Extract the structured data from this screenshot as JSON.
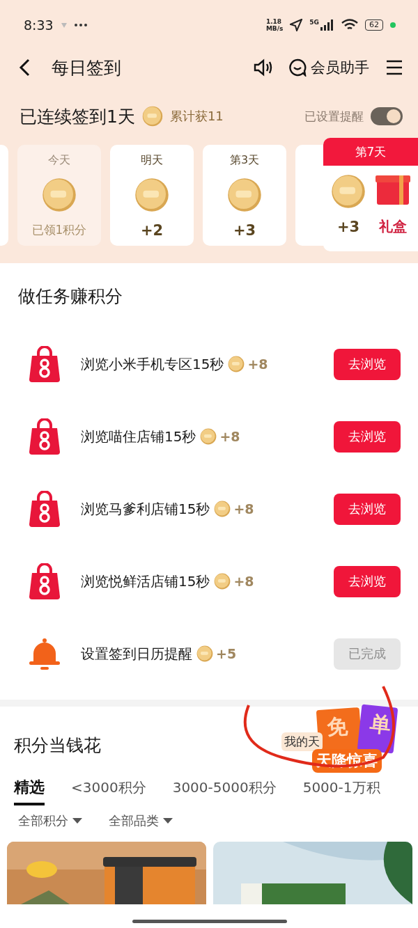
{
  "status_bar": {
    "time": "8:33",
    "speed": [
      "1.18",
      "MB/s"
    ],
    "network": "5G",
    "battery": "62"
  },
  "header": {
    "title": "每日签到",
    "assistant": "会员助手"
  },
  "streak": {
    "text": "已连续签到1天",
    "total": "累计获11",
    "reminder_label": "已设置提醒",
    "reminder_on": true
  },
  "days": [
    {
      "label": "今天",
      "reward": "已领1积分",
      "claimed": true
    },
    {
      "label": "明天",
      "reward": "+2",
      "claimed": false
    },
    {
      "label": "第3天",
      "reward": "+3",
      "claimed": false
    }
  ],
  "final_day": {
    "label": "第7天",
    "reward": "+3",
    "gift": "礼盒"
  },
  "tasks_section": {
    "title": "做任务赚积分",
    "tasks": [
      {
        "kind": "bag",
        "text": "浏览小米手机专区15秒",
        "points": "+8",
        "action": "去浏览",
        "done": false
      },
      {
        "kind": "bag",
        "text": "浏览喵住店铺15秒",
        "points": "+8",
        "action": "去浏览",
        "done": false
      },
      {
        "kind": "bag",
        "text": "浏览马爹利店铺15秒",
        "points": "+8",
        "action": "去浏览",
        "done": false
      },
      {
        "kind": "bag",
        "text": "浏览悦鲜活店铺15秒",
        "points": "+8",
        "action": "去浏览",
        "done": false
      },
      {
        "kind": "bell",
        "text": "设置签到日历提醒",
        "points": "+5",
        "action": "已完成",
        "done": true
      }
    ]
  },
  "promo": {
    "text": "我的天",
    "tickets": [
      "免",
      "单"
    ],
    "banner": "天降惊喜"
  },
  "shop": {
    "title": "积分当钱花",
    "tabs": [
      {
        "label": "精选",
        "selected": true
      },
      {
        "label": "<3000积分",
        "selected": false
      },
      {
        "label": "3000-5000积分",
        "selected": false
      },
      {
        "label": "5000-1万积",
        "selected": false
      }
    ],
    "filters": [
      "全部积分",
      "全部品类"
    ],
    "products": [
      {
        "kind": "picture"
      },
      {
        "kind": "picture"
      }
    ]
  }
}
